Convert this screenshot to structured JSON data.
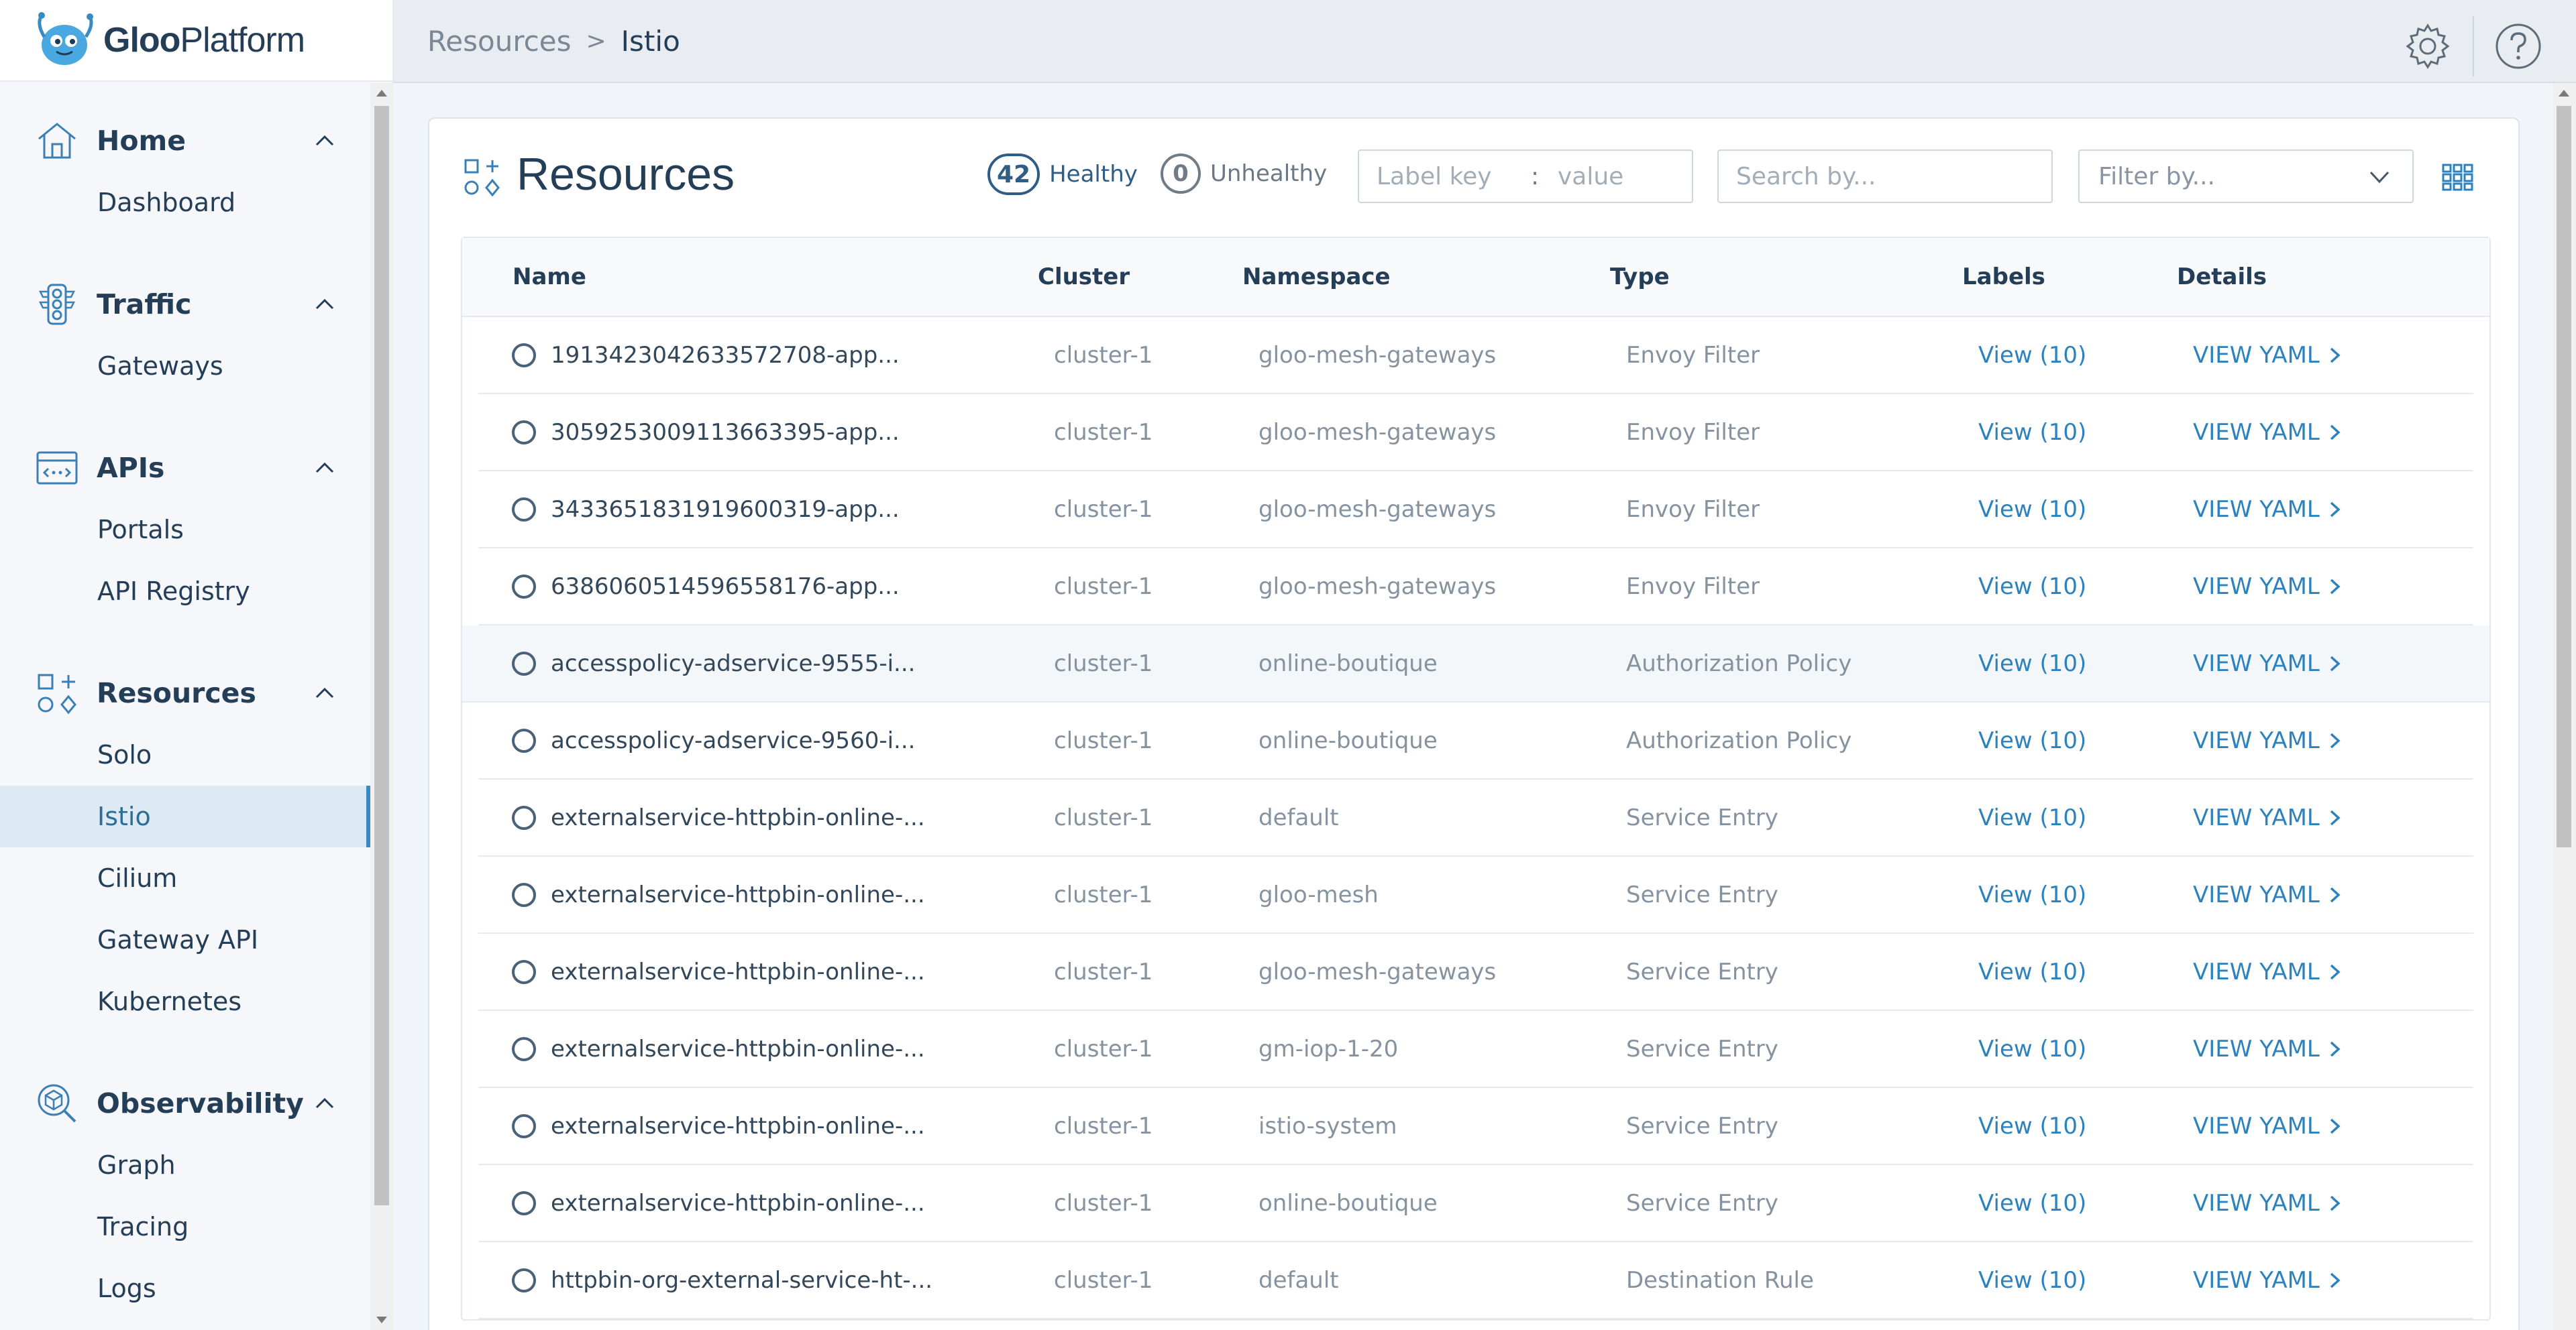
{
  "app": {
    "logo_text_bold": "Gloo",
    "logo_text_regular": "Platform"
  },
  "breadcrumb": {
    "parent": "Resources",
    "separator": ">",
    "current": "Istio"
  },
  "sidebar": {
    "sections": [
      {
        "label": "Home",
        "icon": "home-icon",
        "items": [
          "Dashboard"
        ]
      },
      {
        "label": "Traffic",
        "icon": "traffic-light-icon",
        "items": [
          "Gateways"
        ]
      },
      {
        "label": "APIs",
        "icon": "api-window-icon",
        "items": [
          "Portals",
          "API Registry"
        ]
      },
      {
        "label": "Resources",
        "icon": "resources-grid-icon",
        "items": [
          "Solo",
          "Istio",
          "Cilium",
          "Gateway API",
          "Kubernetes"
        ]
      },
      {
        "label": "Observability",
        "icon": "observability-cube-icon",
        "items": [
          "Graph",
          "Tracing",
          "Logs"
        ]
      }
    ],
    "active_item": "Istio"
  },
  "panel": {
    "title": "Resources",
    "healthy_count": "42",
    "healthy_label": "Healthy",
    "unhealthy_count": "0",
    "unhealthy_label": "Unhealthy",
    "label_key_placeholder": "Label key",
    "label_colon": ":",
    "label_value_placeholder": "value",
    "search_placeholder": "Search by...",
    "filter_placeholder": "Filter by..."
  },
  "table": {
    "columns": [
      "Name",
      "Cluster",
      "Namespace",
      "Type",
      "Labels",
      "Details"
    ],
    "rows": [
      {
        "name": "1913423042633572708-app...",
        "cluster": "cluster-1",
        "namespace": "gloo-mesh-gateways",
        "type": "Envoy Filter",
        "labels": "View (10)",
        "details": "VIEW YAML"
      },
      {
        "name": "305925300911366339​5-app...",
        "cluster": "cluster-1",
        "namespace": "gloo-mesh-gateways",
        "type": "Envoy Filter",
        "labels": "View (10)",
        "details": "VIEW YAML"
      },
      {
        "name": "3433651831919600319-app...",
        "cluster": "cluster-1",
        "namespace": "gloo-mesh-gateways",
        "type": "Envoy Filter",
        "labels": "View (10)",
        "details": "VIEW YAML"
      },
      {
        "name": "6386060514596558176-app...",
        "cluster": "cluster-1",
        "namespace": "gloo-mesh-gateways",
        "type": "Envoy Filter",
        "labels": "View (10)",
        "details": "VIEW YAML"
      },
      {
        "name": "accesspolicy-adservice-9555-i...",
        "cluster": "cluster-1",
        "namespace": "online-boutique",
        "type": "Authorization Policy",
        "labels": "View (10)",
        "details": "VIEW YAML"
      },
      {
        "name": "accesspolicy-adservice-9560-i...",
        "cluster": "cluster-1",
        "namespace": "online-boutique",
        "type": "Authorization Policy",
        "labels": "View (10)",
        "details": "VIEW YAML"
      },
      {
        "name": "externalservice-httpbin-online-...",
        "cluster": "cluster-1",
        "namespace": "default",
        "type": "Service Entry",
        "labels": "View (10)",
        "details": "VIEW YAML"
      },
      {
        "name": "externalservice-httpbin-online-...",
        "cluster": "cluster-1",
        "namespace": "gloo-mesh",
        "type": "Service Entry",
        "labels": "View (10)",
        "details": "VIEW YAML"
      },
      {
        "name": "externalservice-httpbin-online-...",
        "cluster": "cluster-1",
        "namespace": "gloo-mesh-gateways",
        "type": "Service Entry",
        "labels": "View (10)",
        "details": "VIEW YAML"
      },
      {
        "name": "externalservice-httpbin-online-...",
        "cluster": "cluster-1",
        "namespace": "gm-iop-1-20",
        "type": "Service Entry",
        "labels": "View (10)",
        "details": "VIEW YAML"
      },
      {
        "name": "externalservice-httpbin-online-...",
        "cluster": "cluster-1",
        "namespace": "istio-system",
        "type": "Service Entry",
        "labels": "View (10)",
        "details": "VIEW YAML"
      },
      {
        "name": "externalservice-httpbin-online-...",
        "cluster": "cluster-1",
        "namespace": "online-boutique",
        "type": "Service Entry",
        "labels": "View (10)",
        "details": "VIEW YAML"
      },
      {
        "name": "httpbin-org-external-service-ht-...",
        "cluster": "cluster-1",
        "namespace": "default",
        "type": "Destination Rule",
        "labels": "View (10)",
        "details": "VIEW YAML"
      }
    ]
  },
  "colors": {
    "accent": "#2b82bf",
    "text_primary": "#253e58",
    "text_muted": "#8592a0",
    "active_bg": "#dde9f3"
  }
}
